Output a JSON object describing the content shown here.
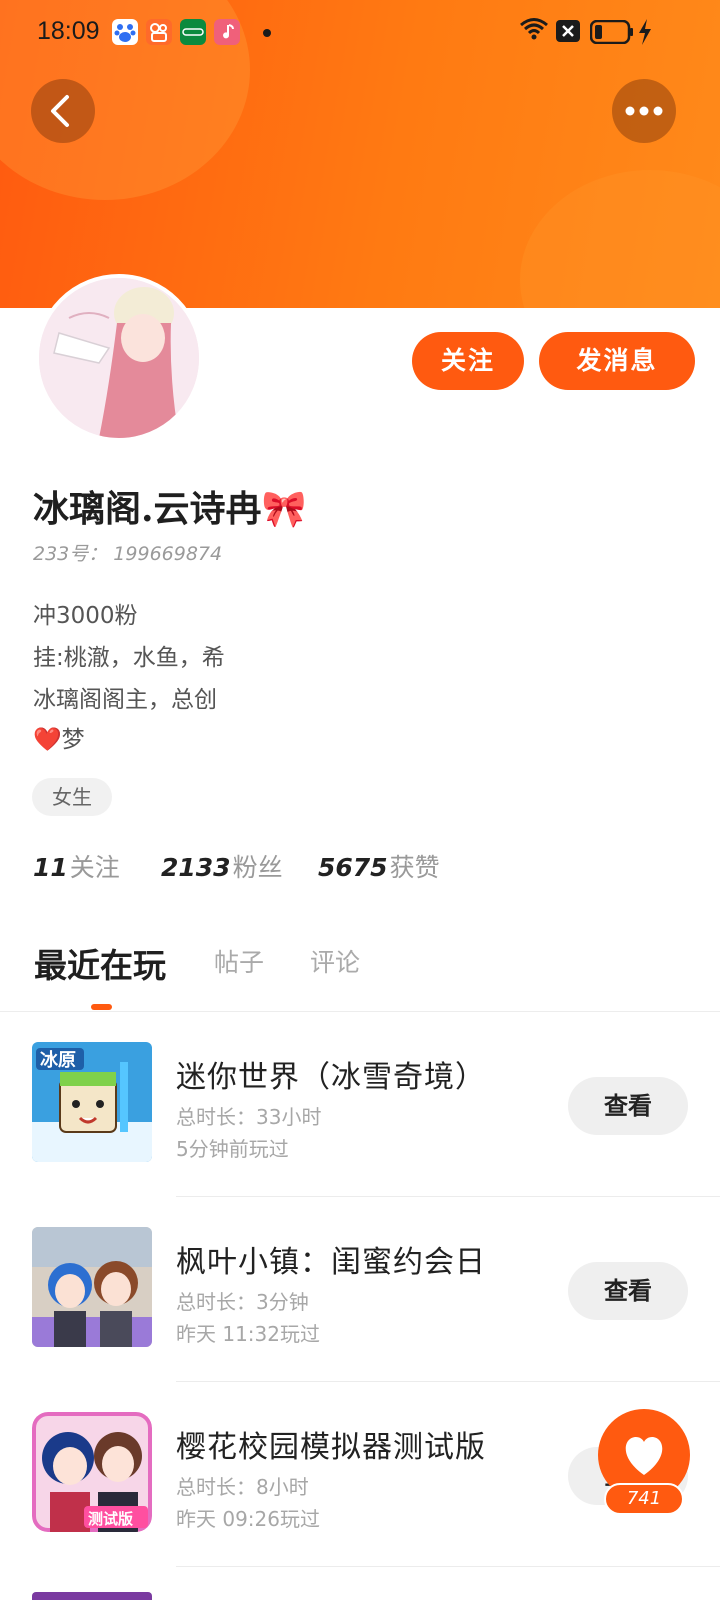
{
  "status_bar": {
    "time": "18:09",
    "notification_icons": [
      "baidu-app-icon",
      "kuaishou-app-icon",
      "oppo-app-icon",
      "music-app-icon"
    ],
    "right_icons": [
      "wifi-icon",
      "close-box-icon",
      "battery-icon",
      "charging-icon"
    ]
  },
  "header": {
    "back_icon": "chevron-left-icon",
    "more_icon": "more-horizontal-icon"
  },
  "profile": {
    "name": "冰璃阁.云诗冉🎀",
    "id_text": "233号： 199669874",
    "bio": [
      "冲3000粉",
      "挂:桃澈，水鱼，希",
      "冰璃阁阁主，总创",
      "❤️梦"
    ],
    "gender_tag": "女生",
    "follow_label": "关注",
    "message_label": "发消息"
  },
  "stats": {
    "following_count": "11",
    "following_label": "关注",
    "fans_count": "2133",
    "fans_label": "粉丝",
    "likes_count": "5675",
    "likes_label": "获赞"
  },
  "tabs": [
    "最近在玩",
    "帖子",
    "评论"
  ],
  "active_tab": 0,
  "games": [
    {
      "name": "迷你世界（冰雪奇境）",
      "duration": "总时长：33小时",
      "last_played": "5分钟前玩过",
      "button": "查看",
      "thumb_text": "冰原"
    },
    {
      "name": "枫叶小镇：闺蜜约会日",
      "duration": "总时长：3分钟",
      "last_played": "昨天 11:32玩过",
      "button": "查看",
      "thumb_text": ""
    },
    {
      "name": "樱花校园模拟器测试版",
      "duration": "总时长：8小时",
      "last_played": "昨天 09:26玩过",
      "button": "查看",
      "thumb_text": "测试版"
    }
  ],
  "like_button": {
    "count": "741"
  },
  "colors": {
    "accent": "#ff5a10",
    "banner": "#ff7a12"
  }
}
